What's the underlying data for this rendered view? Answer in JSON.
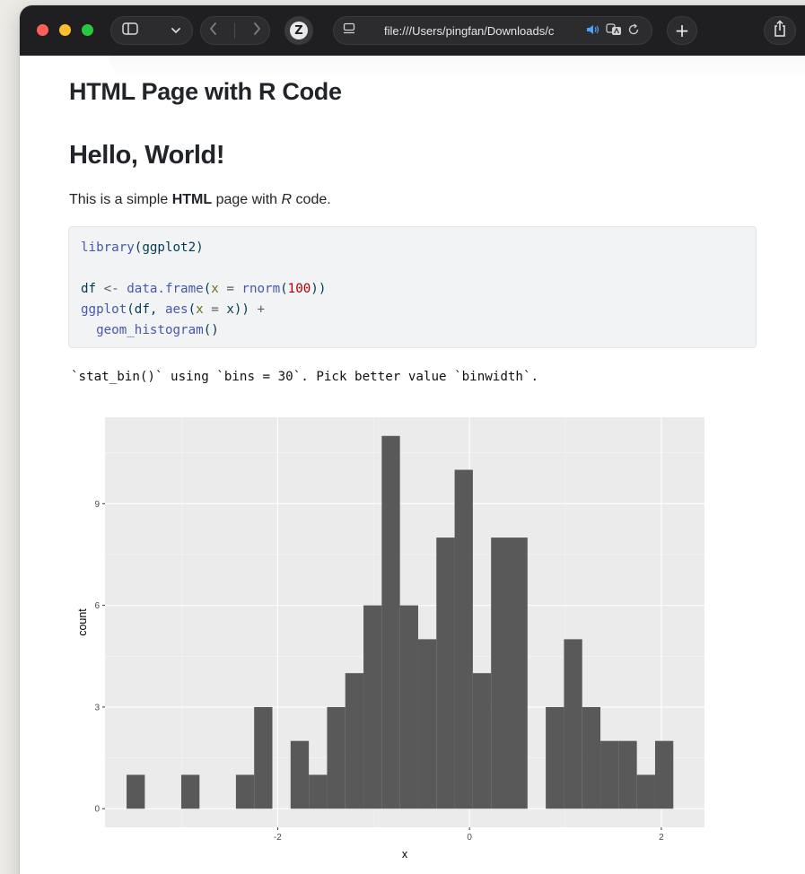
{
  "browser": {
    "url": "file:///Users/pingfan/Downloads/c",
    "new_tab_symbol": "+",
    "z_label": "Z"
  },
  "page": {
    "title": "HTML Page with R Code",
    "heading": "Hello, World!",
    "intro": {
      "pre": "This is a simple ",
      "bold": "HTML",
      "mid": " page with ",
      "ital": "R",
      "post": " code."
    },
    "code": {
      "line1": {
        "fn": "library",
        "open": "(",
        "arg": "ggplot2",
        "close": ")"
      },
      "line3": {
        "var": "df ",
        "assign": "<-",
        "sp": " ",
        "fn": "data.frame",
        "open": "(",
        "arg": "x",
        "eq": " = ",
        "fn2": "rnorm",
        "open2": "(",
        "num": "100",
        "close": "))"
      },
      "line4": {
        "fn": "ggplot",
        "open": "(df, ",
        "fn2": "aes",
        "open2": "(",
        "arg": "x",
        "eq": " = ",
        "rest": "x)) ",
        "plus": "+"
      },
      "line5": {
        "indent": "  ",
        "fn": "geom_histogram",
        "close": "()"
      }
    },
    "message": "`stat_bin()` using `bins = 30`. Pick better value `binwidth`."
  },
  "chart_data": {
    "type": "bar",
    "title": "",
    "xlabel": "x",
    "ylabel": "count",
    "xlim": [
      -3.8,
      2.45
    ],
    "ylim": [
      -0.55,
      11.55
    ],
    "x_ticks": [
      -2,
      0,
      2
    ],
    "y_ticks": [
      0,
      3,
      6,
      9
    ],
    "bin_width": 0.19,
    "first_bin_center": -3.48,
    "counts": [
      1,
      0,
      0,
      1,
      0,
      0,
      1,
      3,
      0,
      2,
      1,
      3,
      4,
      6,
      11,
      6,
      5,
      8,
      10,
      4,
      8,
      8,
      0,
      3,
      5,
      3,
      2,
      2,
      1,
      2
    ],
    "colors": {
      "panel": "#ebebeb",
      "grid_major": "#ffffff",
      "bar": "#595959",
      "text": "#4d4d4d",
      "axis_title": "#000000"
    },
    "grid": true
  }
}
